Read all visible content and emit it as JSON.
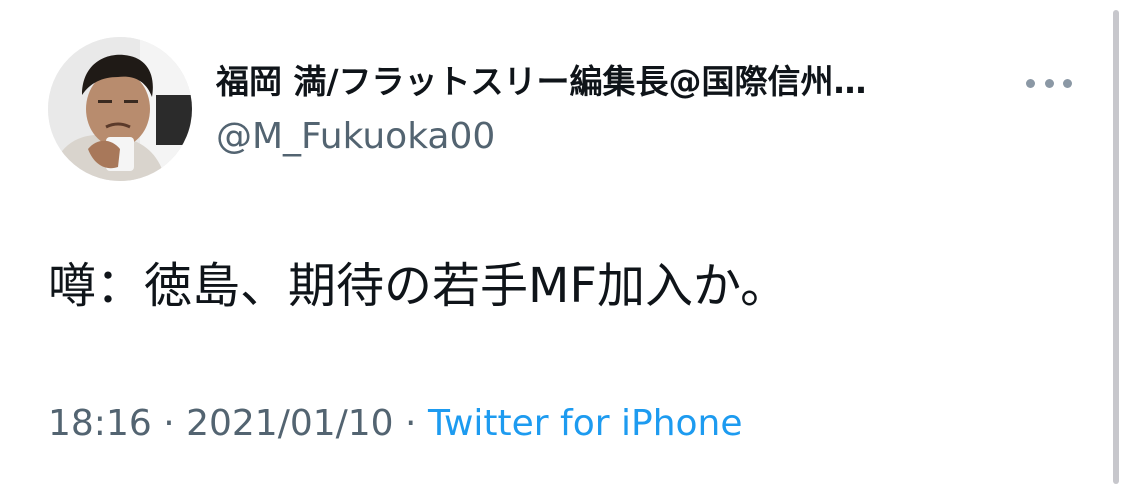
{
  "author": {
    "display_name": "福岡 満/フラットスリー編集長@国際信州…",
    "handle": "@M_Fukuoka00"
  },
  "tweet": {
    "text": "噂：徳島、期待の若手MF加入か。",
    "time": "18:16",
    "separator_1": " · ",
    "date": "2021/01/10",
    "separator_2": " · ",
    "source": "Twitter for iPhone"
  },
  "icons": {
    "more": "more-horizontal-icon",
    "avatar": "profile-photo"
  },
  "colors": {
    "text_primary": "#0f1419",
    "text_secondary": "#536471",
    "link": "#1d9bf0"
  }
}
